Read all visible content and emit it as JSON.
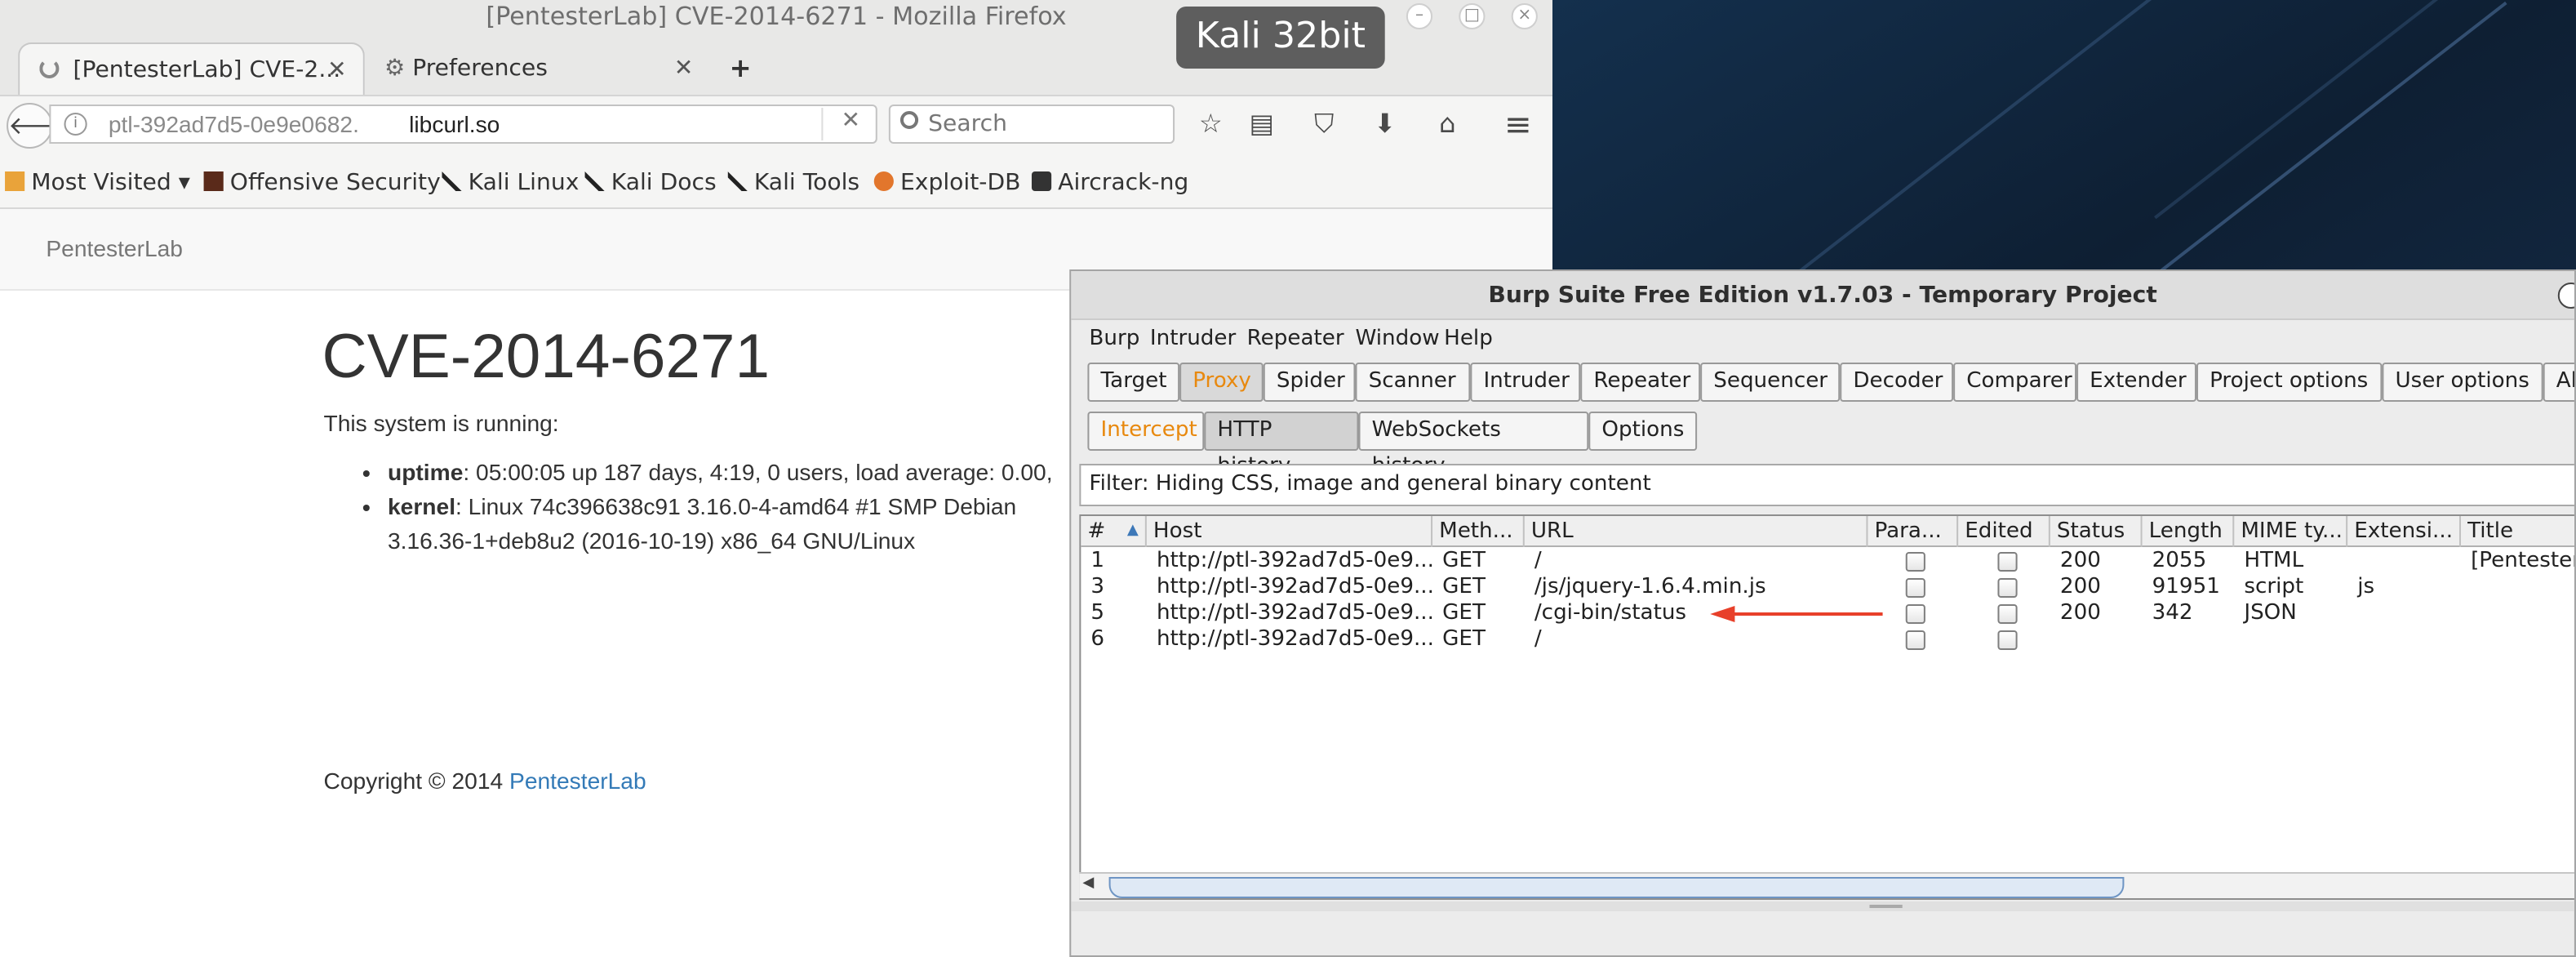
{
  "desktop": {
    "badge": "Kali 32bit"
  },
  "firefox": {
    "window_title": "[PentesterLab] CVE-2014-6271 - Mozilla Firefox",
    "tabs": [
      {
        "label": "[PentesterLab] CVE-2...",
        "icon": "loading-icon"
      },
      {
        "label": "Preferences",
        "icon": "gear-icon"
      }
    ],
    "new_tab": "+",
    "url": {
      "prefix": "ptl-392ad7d5-0e9e0682.",
      "domain": "libcurl.so"
    },
    "search_placeholder": "Search",
    "bookmarks": [
      {
        "label": "Most Visited ▾",
        "icon": "bookmarks-icon"
      },
      {
        "label": "Offensive Security",
        "icon": "offsec-icon"
      },
      {
        "label": "Kali Linux",
        "icon": "kali-dragon-icon"
      },
      {
        "label": "Kali Docs",
        "icon": "kali-dragon-icon"
      },
      {
        "label": "Kali Tools",
        "icon": "kali-dragon-icon"
      },
      {
        "label": "Exploit-DB",
        "icon": "exploitdb-icon"
      },
      {
        "label": "Aircrack-ng",
        "icon": "aircrack-icon"
      }
    ]
  },
  "page": {
    "brand": "PentesterLab",
    "heading": "CVE-2014-6271",
    "lead": "This system is running:",
    "items": [
      {
        "key": "uptime",
        "value": ": 05:00:05 up 187 days, 4:19, 0 users, load average: 0.00,"
      },
      {
        "key": "kernel",
        "value": ": Linux 74c396638c91 3.16.0-4-amd64 #1 SMP Debian 3.16.36-1+deb8u2 (2016-10-19) x86_64 GNU/Linux"
      }
    ],
    "copyright": "Copyright © 2014 ",
    "copyright_link": "PentesterLab"
  },
  "burp": {
    "title": "Burp Suite Free Edition v1.7.03 - Temporary Project",
    "menu": [
      "Burp",
      "Intruder",
      "Repeater",
      "Window",
      "Help"
    ],
    "tabs": [
      "Target",
      "Proxy",
      "Spider",
      "Scanner",
      "Intruder",
      "Repeater",
      "Sequencer",
      "Decoder",
      "Comparer",
      "Extender",
      "Project options",
      "User options",
      "Ale"
    ],
    "subtabs": [
      "Intercept",
      "HTTP history",
      "WebSockets history",
      "Options"
    ],
    "filter": "Filter: Hiding CSS, image and general binary content",
    "columns": [
      "#",
      "Host",
      "Meth...",
      "URL",
      "Para...",
      "Edited",
      "Status",
      "Length",
      "MIME ty...",
      "Extensi...",
      "Title"
    ],
    "rows": [
      {
        "num": "1",
        "host": "http://ptl-392ad7d5-0e9...",
        "method": "GET",
        "url": "/",
        "status": "200",
        "length": "2055",
        "mime": "HTML",
        "ext": "",
        "title": "[Pentester"
      },
      {
        "num": "3",
        "host": "http://ptl-392ad7d5-0e9...",
        "method": "GET",
        "url": "/js/jquery-1.6.4.min.js",
        "status": "200",
        "length": "91951",
        "mime": "script",
        "ext": "js",
        "title": ""
      },
      {
        "num": "5",
        "host": "http://ptl-392ad7d5-0e9...",
        "method": "GET",
        "url": "/cgi-bin/status",
        "status": "200",
        "length": "342",
        "mime": "JSON",
        "ext": "",
        "title": ""
      },
      {
        "num": "6",
        "host": "http://ptl-392ad7d5-0e9...",
        "method": "GET",
        "url": "/",
        "status": "",
        "length": "",
        "mime": "",
        "ext": "",
        "title": ""
      }
    ],
    "annotation_color": "#e8402a"
  }
}
